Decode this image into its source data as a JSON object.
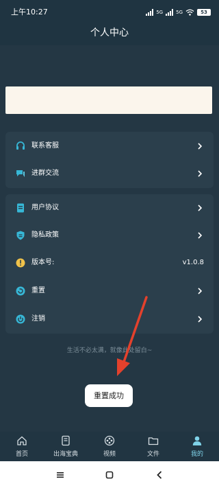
{
  "status_bar": {
    "time": "上午10:27",
    "signal_1": "5G",
    "signal_2": "5G",
    "battery": "53"
  },
  "header": {
    "title": "个人中心"
  },
  "menu_group_1": [
    {
      "label": "联系客服",
      "icon": "headset-icon"
    },
    {
      "label": "进群交流",
      "icon": "group-chat-icon"
    }
  ],
  "menu_group_2": [
    {
      "label": "用户协议",
      "icon": "document-icon"
    },
    {
      "label": "隐私政策",
      "icon": "shield-icon"
    },
    {
      "label": "版本号:",
      "icon": "info-icon",
      "value": "v1.0.8"
    },
    {
      "label": "重置",
      "icon": "refresh-icon"
    },
    {
      "label": "注销",
      "icon": "power-icon"
    }
  ],
  "slogan": "生活不必太满，就像此处留白~",
  "toast": {
    "message": "重置成功"
  },
  "bottom_nav": [
    {
      "label": "首页",
      "icon": "home-icon"
    },
    {
      "label": "出海宝典",
      "icon": "book-icon"
    },
    {
      "label": "视频",
      "icon": "video-icon"
    },
    {
      "label": "文件",
      "icon": "folder-icon"
    },
    {
      "label": "我的",
      "icon": "user-icon",
      "active": true
    }
  ],
  "colors": {
    "background": "#243744",
    "card": "#2b3f4c",
    "accent": "#37b7d6",
    "warning": "#f0c24a",
    "arrow": "#e3412c"
  }
}
